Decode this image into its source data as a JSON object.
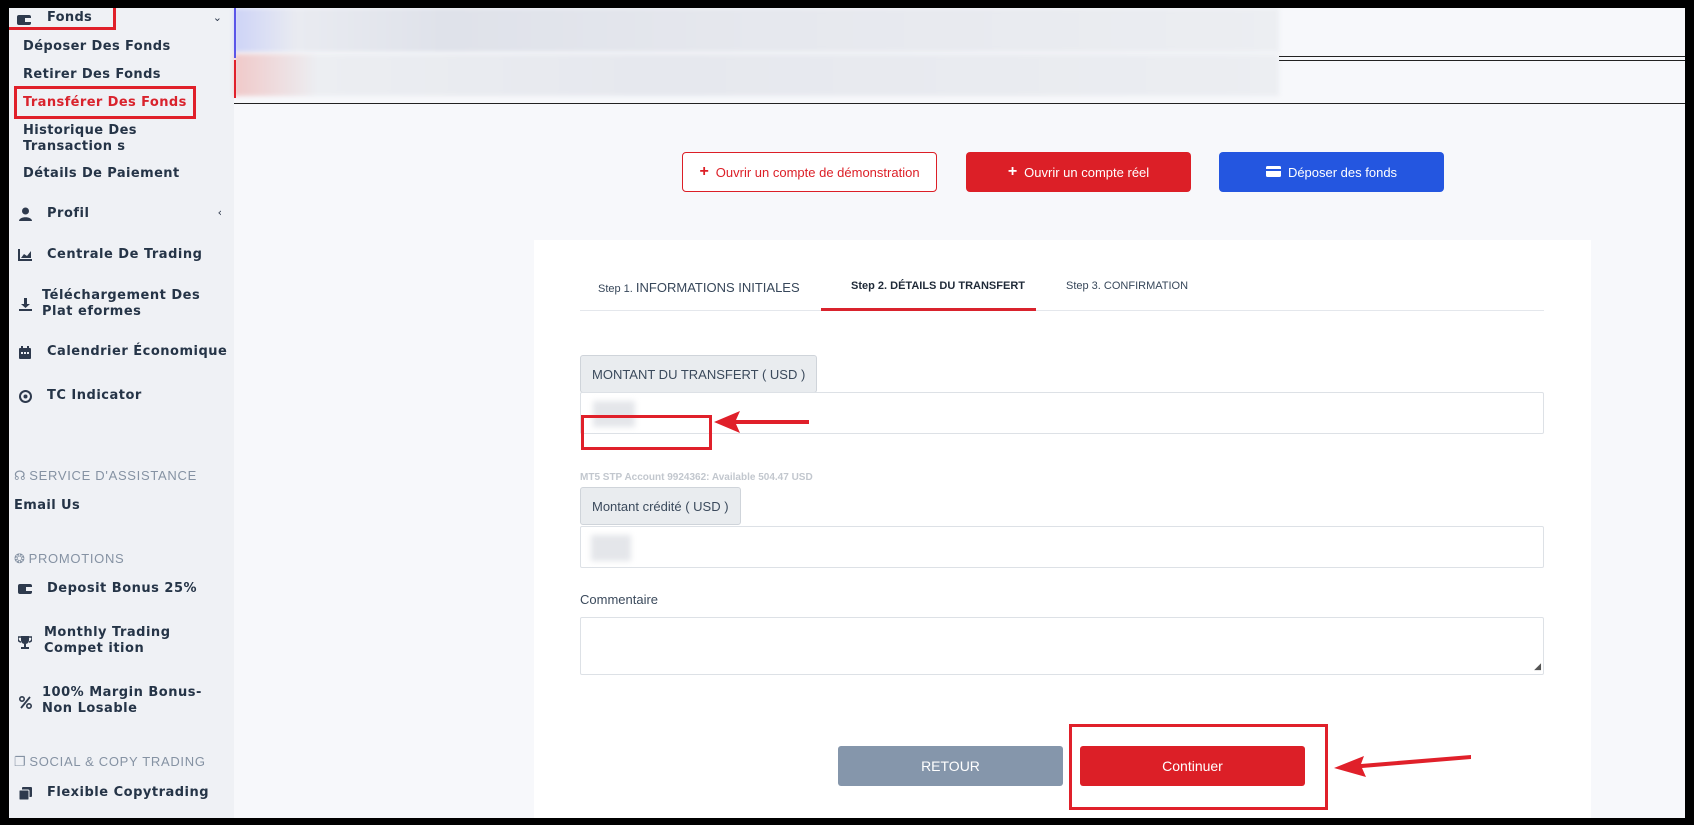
{
  "sidebar": {
    "fonds": {
      "label": "Fonds",
      "icon": "wallet-icon"
    },
    "sub_items": [
      {
        "label": "Déposer Des Fonds"
      },
      {
        "label": "Retirer Des Fonds"
      },
      {
        "label": "Transférer Des Fonds"
      },
      {
        "label": "Historique Des Transaction s"
      },
      {
        "label": "Détails De Paiement"
      }
    ],
    "items": [
      {
        "label": "Profil",
        "icon": "user-icon"
      },
      {
        "label": "Centrale De Trading",
        "icon": "chart-icon"
      },
      {
        "label": "Téléchargement Des Plat eformes",
        "icon": "download-icon"
      },
      {
        "label": "Calendrier Économique",
        "icon": "calendar-icon"
      },
      {
        "label": "TC Indicator",
        "icon": "target-icon"
      }
    ],
    "support_section": "SERVICE D'ASSISTANCE",
    "email_us": "Email Us",
    "promotions_section": "PROMOTIONS",
    "promotions": [
      {
        "label": "Deposit Bonus 25%",
        "icon": "wallet-icon"
      },
      {
        "label": "Monthly Trading Compet ition",
        "icon": "trophy-icon"
      },
      {
        "label": "100% Margin Bonus- Non Losable",
        "icon": "percent-icon"
      }
    ],
    "social_section": "SOCIAL & COPY TRADING",
    "social": [
      {
        "label": "Flexible Copytrading",
        "icon": "copy-icon"
      }
    ]
  },
  "actions": {
    "demo": "Ouvrir un compte de démonstration",
    "real": "Ouvrir un compte réel",
    "deposit": "Déposer des fonds"
  },
  "steps": [
    {
      "prefix": "Step 1.",
      "label": "INFORMATIONS INITIALES"
    },
    {
      "prefix": "Step 2.",
      "label": "DÉTAILS DU TRANSFERT"
    },
    {
      "prefix": "Step 3.",
      "label": "CONFIRMATION"
    }
  ],
  "form": {
    "amount_label": "MONTANT DU TRANSFERT ( USD )",
    "account_info": "MT5 STP Account 9924362: Available 504.47 USD",
    "credited_label": "Montant crédité ( USD )",
    "comment_label": "Commentaire",
    "back_button": "RETOUR",
    "continue_button": "Continuer"
  },
  "colors": {
    "accent_red": "#dc1f27",
    "primary_blue": "#2456e0",
    "secondary_gray": "#8596ab"
  }
}
